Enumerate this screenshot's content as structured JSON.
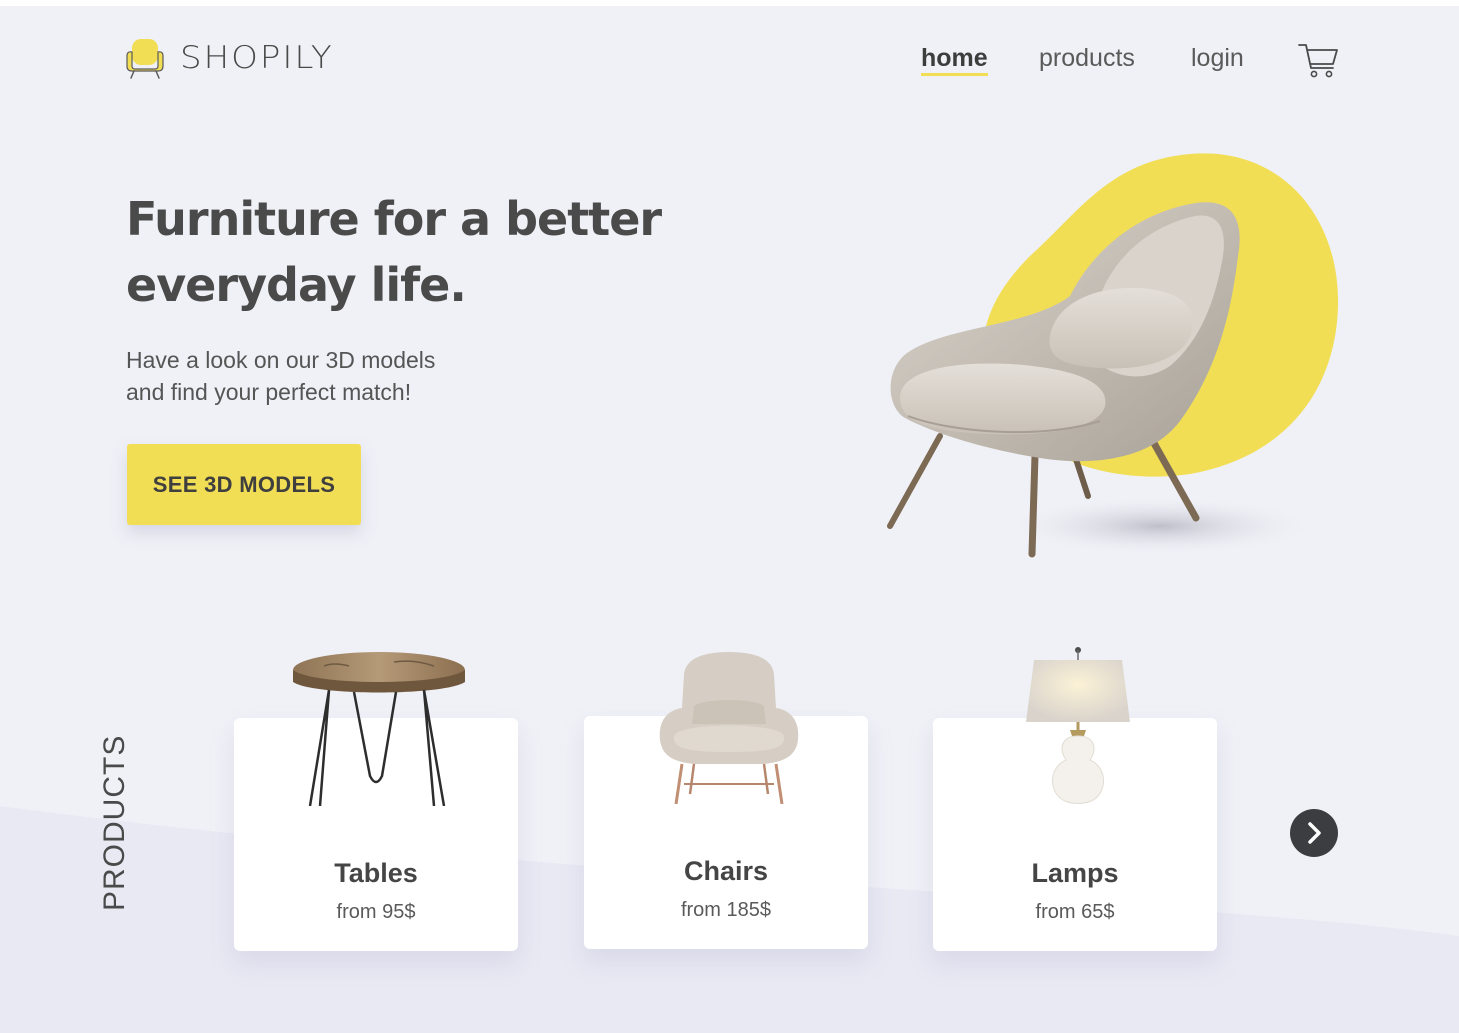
{
  "brand": {
    "name": "SHOPILY",
    "accent_color": "#f1de55"
  },
  "nav": {
    "items": [
      {
        "label": "home",
        "active": true
      },
      {
        "label": "products",
        "active": false
      },
      {
        "label": "login",
        "active": false
      }
    ],
    "cart_icon": "cart-icon"
  },
  "hero": {
    "title_line1": "Furniture for a better",
    "title_line2": "everyday life.",
    "subtitle_line1": "Have a look on our 3D models",
    "subtitle_line2": "and find your perfect match!",
    "cta_label": "SEE 3D MODELS",
    "image": "armchair-image"
  },
  "products": {
    "section_label": "PRODUCTS",
    "cards": [
      {
        "title": "Tables",
        "price": "from 95$",
        "image": "side-table-image"
      },
      {
        "title": "Chairs",
        "price": "from 185$",
        "image": "lounge-chair-image"
      },
      {
        "title": "Lamps",
        "price": "from 65$",
        "image": "table-lamp-image"
      }
    ],
    "next_icon": "chevron-right-icon"
  }
}
